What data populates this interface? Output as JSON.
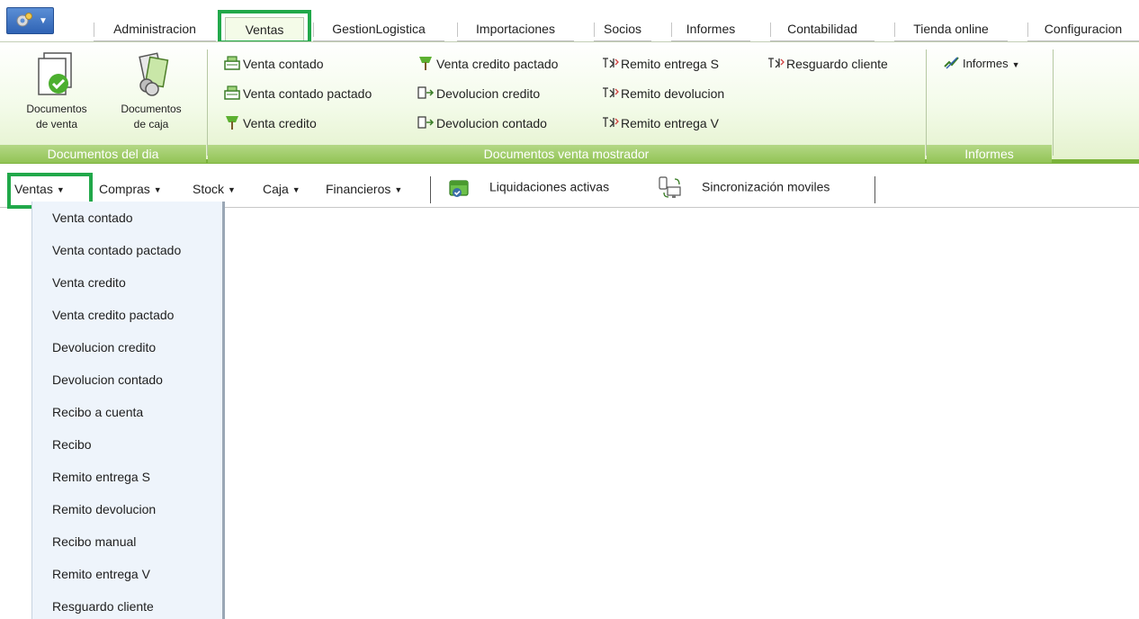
{
  "tabs": [
    {
      "label": "Administracion",
      "active": false
    },
    {
      "label": "Ventas",
      "active": true
    },
    {
      "label": "GestionLogistica",
      "active": false
    },
    {
      "label": "Importaciones",
      "active": false
    },
    {
      "label": "Socios",
      "active": false
    },
    {
      "label": "Informes",
      "active": false
    },
    {
      "label": "Contabilidad",
      "active": false
    },
    {
      "label": "Tienda online",
      "active": false
    },
    {
      "label": "Configuracion",
      "active": false
    }
  ],
  "ribbon": {
    "groups": {
      "documentos_dia": "Documentos del dia",
      "venta_mostrador": "Documentos venta mostrador",
      "informes": "Informes"
    },
    "big_buttons": {
      "documentos_venta": {
        "line1": "Documentos",
        "line2": "de venta"
      },
      "documentos_caja": {
        "line1": "Documentos",
        "line2": "de caja"
      }
    },
    "small_buttons": [
      {
        "label": "Venta contado",
        "icon": "register-icon"
      },
      {
        "label": "Venta contado pactado",
        "icon": "register-icon"
      },
      {
        "label": "Venta credito",
        "icon": "money-tree-icon"
      },
      {
        "label": "Venta credito pactado",
        "icon": "money-tree-icon"
      },
      {
        "label": "Devolucion credito",
        "icon": "return-doc-icon"
      },
      {
        "label": "Devolucion contado",
        "icon": "return-doc-icon"
      },
      {
        "label": "Remito entrega S",
        "icon": "delivery-note-icon"
      },
      {
        "label": "Remito devolucion",
        "icon": "delivery-note-icon"
      },
      {
        "label": "Remito entrega V",
        "icon": "delivery-note-icon"
      },
      {
        "label": "Resguardo cliente",
        "icon": "delivery-note-icon"
      }
    ],
    "informes_label": "Informes"
  },
  "toolbar": {
    "ventas": "Ventas",
    "compras": "Compras",
    "stock": "Stock",
    "caja": "Caja",
    "financieros": "Financieros",
    "liquidaciones": "Liquidaciones activas",
    "sincronizacion": "Sincronización moviles"
  },
  "dropdown": [
    "Venta contado",
    "Venta contado pactado",
    "Venta credito",
    "Venta credito pactado",
    "Devolucion credito",
    "Devolucion contado",
    "Recibo a cuenta",
    "Recibo",
    "Remito entrega S",
    "Remito devolucion",
    "Recibo manual",
    "Remito entrega V",
    "Resguardo cliente"
  ],
  "colors": {
    "ribbon_accent": "#7bb33b",
    "highlight_box": "#21a84a",
    "app_button": "#3a70c0",
    "menu_background": "#eef4fb"
  }
}
